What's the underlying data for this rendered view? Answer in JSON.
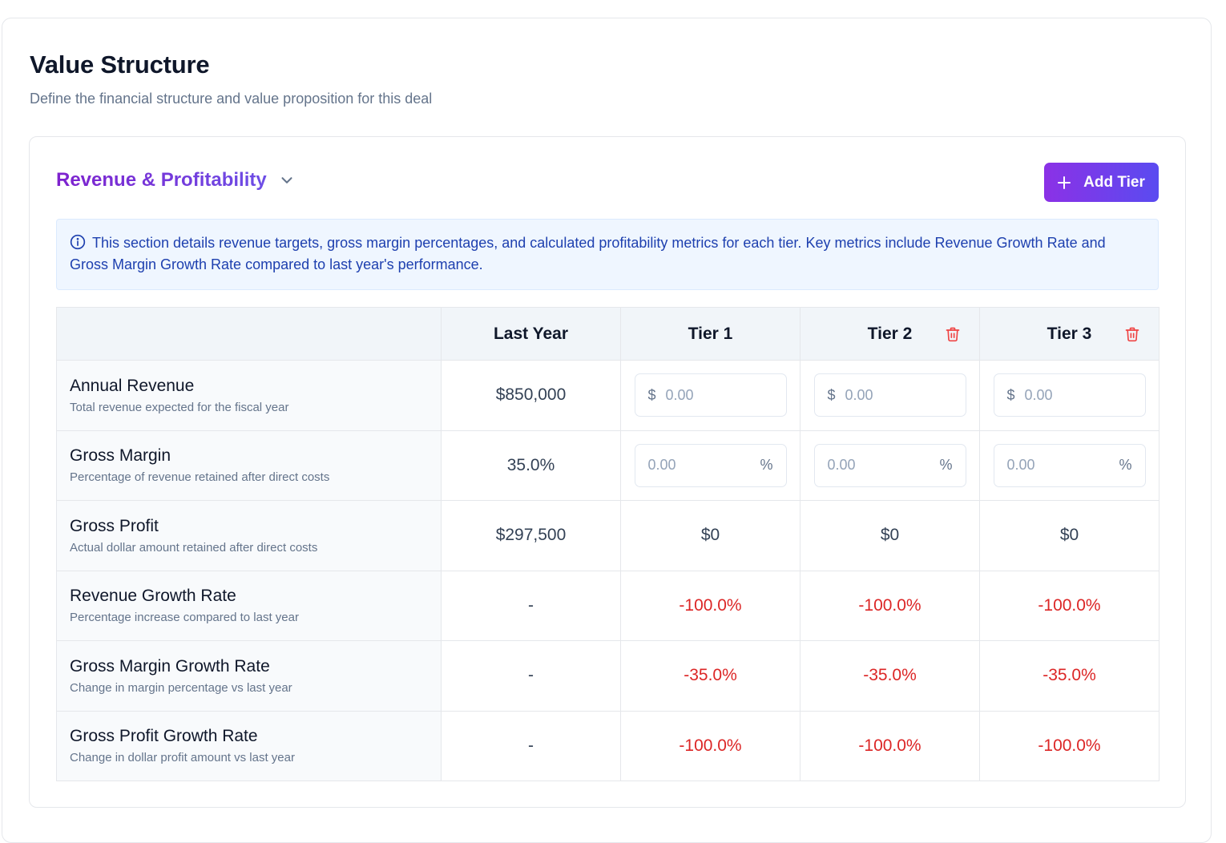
{
  "page": {
    "title": "Value Structure",
    "subtitle": "Define the financial structure and value proposition for this deal"
  },
  "section": {
    "title": "Revenue & Profitability",
    "add_tier_label": "Add Tier",
    "info_text": "This section details revenue targets, gross margin percentages, and calculated profitability metrics for each tier. Key metrics include Revenue Growth Rate and Gross Margin Growth Rate compared to last year's performance."
  },
  "table": {
    "columns": [
      "",
      "Last Year",
      "Tier 1",
      "Tier 2",
      "Tier 3"
    ],
    "currency_prefix": "$",
    "percent_suffix": "%",
    "rows": [
      {
        "name": "Annual Revenue",
        "description": "Total revenue expected for the fiscal year",
        "last_year": "$850,000",
        "tiers": [
          {
            "placeholder": "0.00",
            "value": ""
          },
          {
            "placeholder": "0.00",
            "value": ""
          },
          {
            "placeholder": "0.00",
            "value": ""
          }
        ]
      },
      {
        "name": "Gross Margin",
        "description": "Percentage of revenue retained after direct costs",
        "last_year": "35.0%",
        "tiers": [
          {
            "placeholder": "0.00",
            "value": ""
          },
          {
            "placeholder": "0.00",
            "value": ""
          },
          {
            "placeholder": "0.00",
            "value": ""
          }
        ]
      },
      {
        "name": "Gross Profit",
        "description": "Actual dollar amount retained after direct costs",
        "last_year": "$297,500",
        "tiers": [
          "$0",
          "$0",
          "$0"
        ]
      },
      {
        "name": "Revenue Growth Rate",
        "description": "Percentage increase compared to last year",
        "last_year": "-",
        "tiers": [
          "-100.0%",
          "-100.0%",
          "-100.0%"
        ]
      },
      {
        "name": "Gross Margin Growth Rate",
        "description": "Change in margin percentage vs last year",
        "last_year": "-",
        "tiers": [
          "-35.0%",
          "-35.0%",
          "-35.0%"
        ]
      },
      {
        "name": "Gross Profit Growth Rate",
        "description": "Change in dollar profit amount vs last year",
        "last_year": "-",
        "tiers": [
          "-100.0%",
          "-100.0%",
          "-100.0%"
        ]
      }
    ]
  },
  "colors": {
    "accent_start": "#8b31e6",
    "accent_end": "#5a4bf0",
    "negative": "#dc2626",
    "info_text": "#1e40af",
    "delete_icon": "#ef4444"
  }
}
